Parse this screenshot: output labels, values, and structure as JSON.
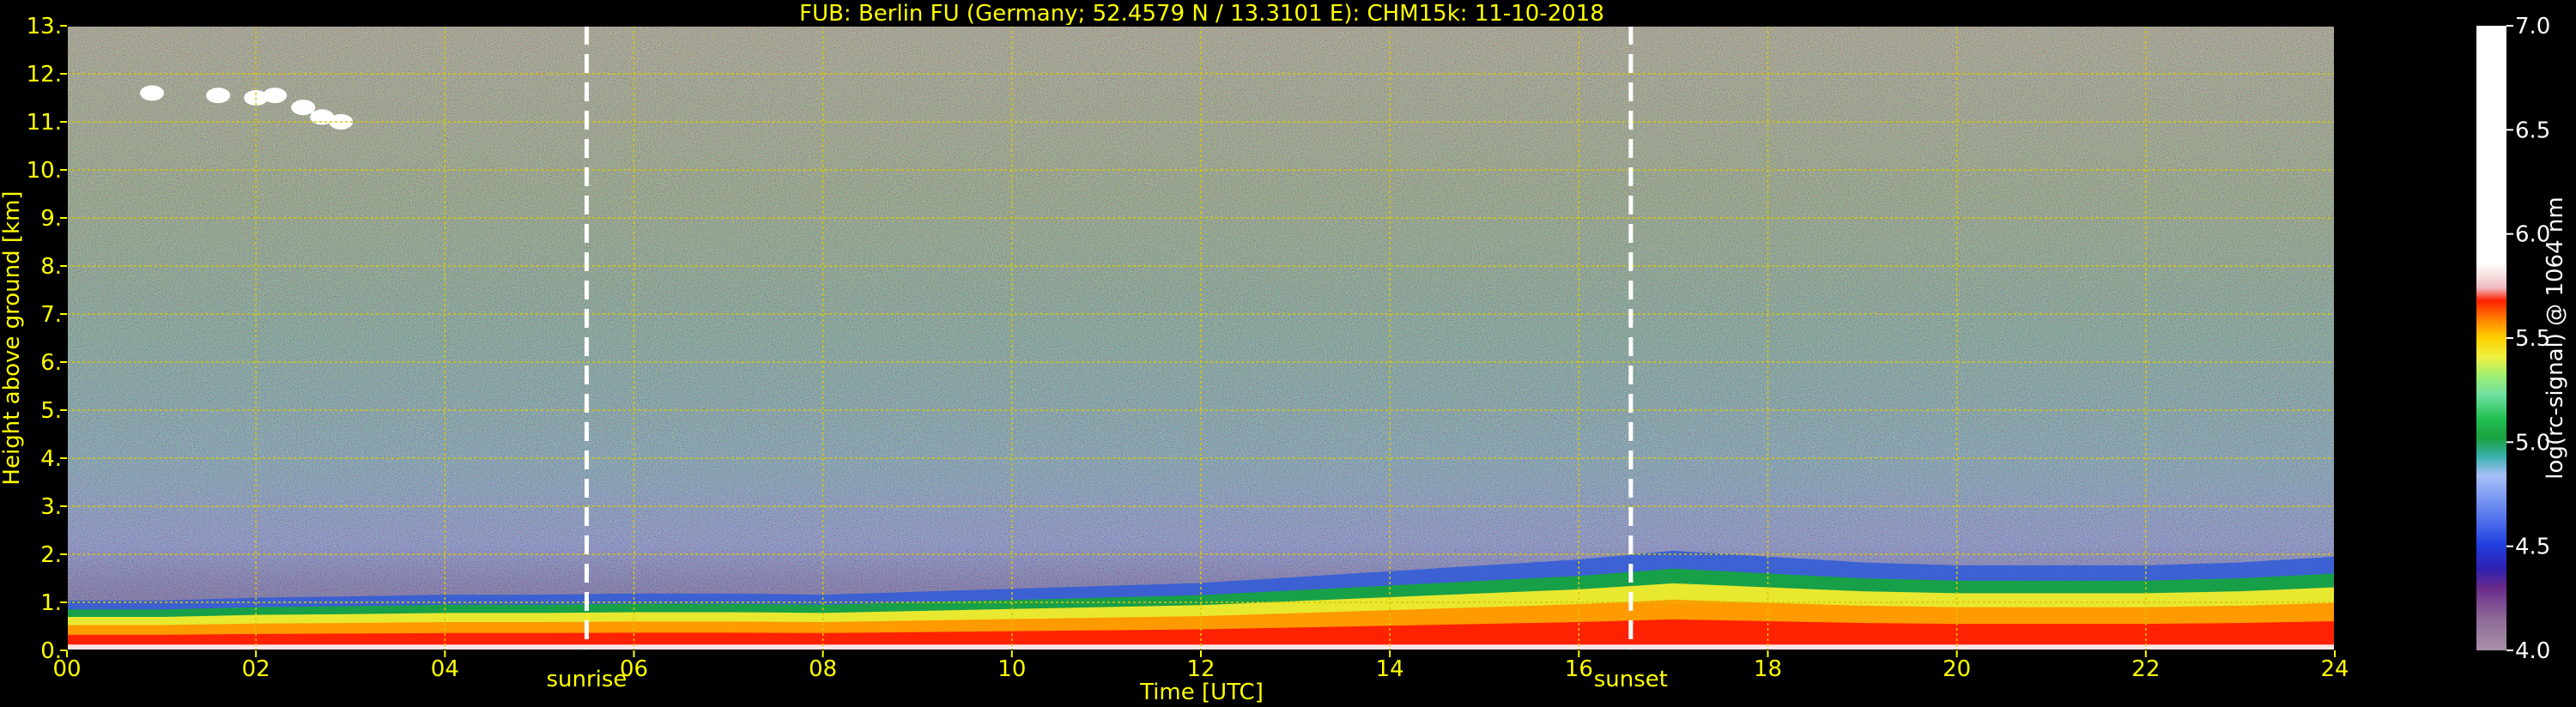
{
  "chart_data": {
    "type": "heatmap",
    "title": "FUB: Berlin FU (Germany; 52.4579 N / 13.3101 E):    CHM15k: 11-10-2018",
    "xlabel": "Time [UTC]",
    "ylabel": "Height above ground [km]",
    "colorbar_label": "log(rc-signal) @ 1064 nm",
    "xlim": [
      0,
      24
    ],
    "ylim": [
      0,
      13
    ],
    "clim": [
      4.0,
      7.0
    ],
    "x_ticks": [
      0,
      2,
      4,
      6,
      8,
      10,
      12,
      14,
      16,
      18,
      20,
      22,
      24
    ],
    "x_tick_labels": [
      "00",
      "02",
      "04",
      "06",
      "08",
      "10",
      "12",
      "14",
      "16",
      "18",
      "20",
      "22",
      "24"
    ],
    "y_ticks": [
      0,
      1,
      2,
      3,
      4,
      5,
      6,
      7,
      8,
      9,
      10,
      11,
      12,
      13
    ],
    "y_tick_labels": [
      "0.",
      "1.",
      "2.",
      "3.",
      "4.",
      "5.",
      "6.",
      "7.",
      "8.",
      "9.",
      "10.",
      "11.",
      "12.",
      "13."
    ],
    "colorbar_ticks": [
      4.0,
      4.5,
      5.0,
      5.5,
      6.0,
      6.5,
      7.0
    ],
    "colorbar_tick_labels": [
      "4.0",
      "4.5",
      "5.0",
      "5.5",
      "6.0",
      "6.5",
      "7.0"
    ],
    "grid": true,
    "events": [
      {
        "label": "sunrise",
        "time": 5.5
      },
      {
        "label": "sunset",
        "time": 16.55
      }
    ],
    "boundary_layer_top_km": {
      "time": [
        0,
        1,
        2,
        3,
        4,
        5,
        6,
        7,
        8,
        9,
        10,
        11,
        12,
        13,
        14,
        15,
        16,
        17,
        18,
        19,
        20,
        21,
        22,
        23,
        24
      ],
      "height": [
        0.85,
        0.85,
        0.9,
        0.92,
        0.95,
        0.95,
        0.97,
        0.97,
        0.95,
        1.0,
        1.05,
        1.1,
        1.15,
        1.25,
        1.35,
        1.45,
        1.55,
        1.7,
        1.6,
        1.5,
        1.45,
        1.45,
        1.45,
        1.5,
        1.6
      ]
    },
    "high_cloud": {
      "time_range": [
        0.8,
        3.0
      ],
      "height_range_km": [
        10.8,
        11.8
      ]
    }
  }
}
